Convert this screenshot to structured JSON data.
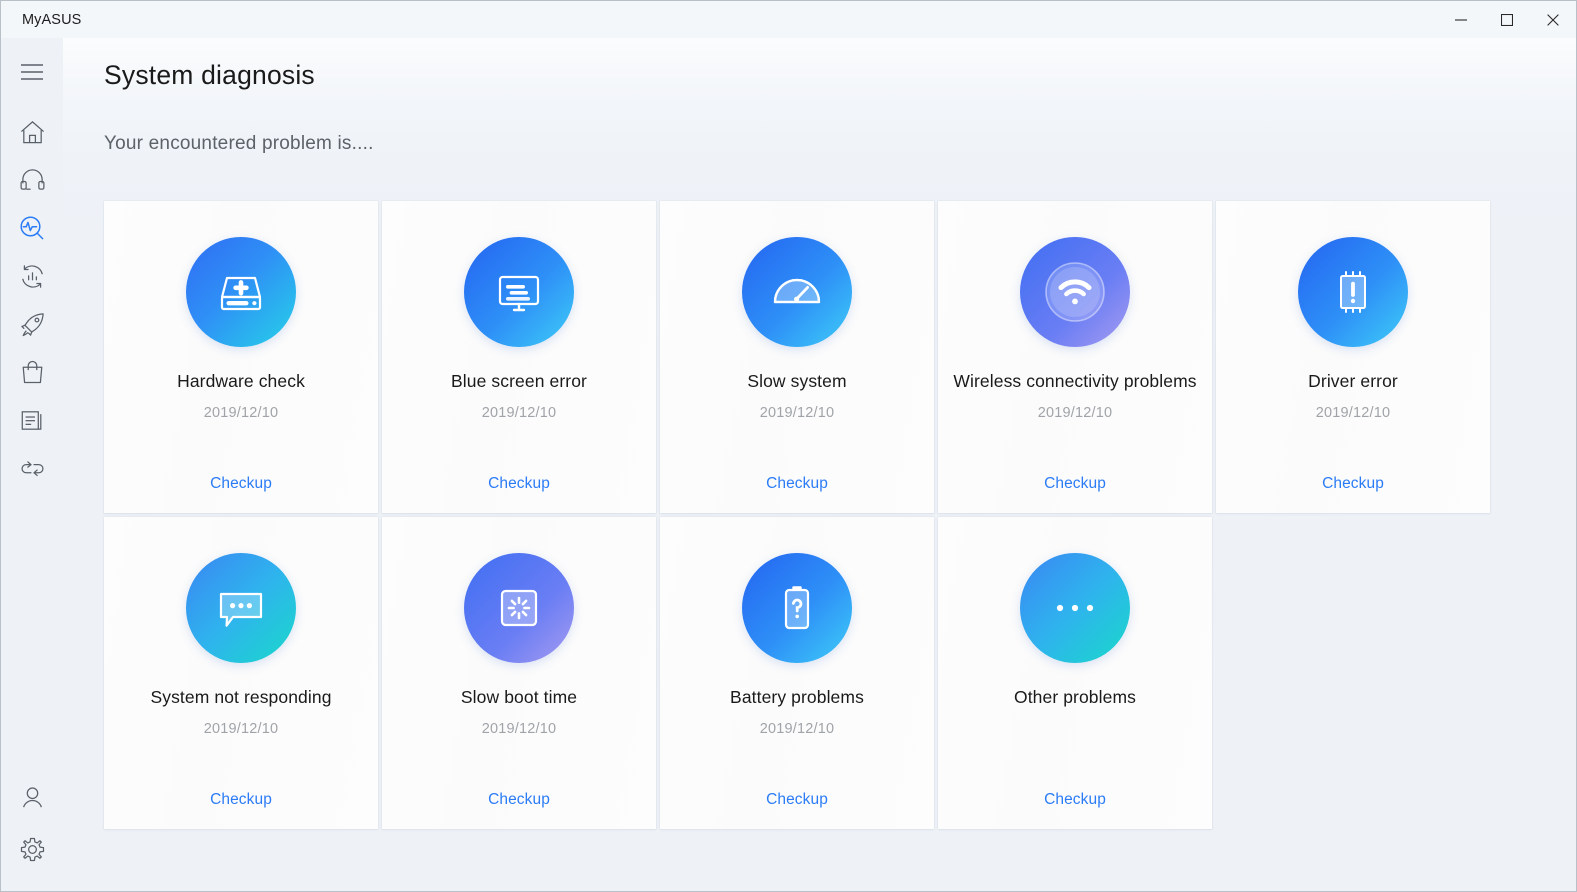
{
  "window": {
    "app_title": "MyASUS",
    "controls": {
      "minimize": "minimize-button",
      "maximize": "maximize-button",
      "close": "close-button"
    }
  },
  "sidebar": {
    "menu_label": "hamburger-menu",
    "items": [
      {
        "icon": "home-icon",
        "name": "home",
        "active": false
      },
      {
        "icon": "headset-icon",
        "name": "support",
        "active": false
      },
      {
        "icon": "diagnosis-icon",
        "name": "diagnosis",
        "active": true
      },
      {
        "icon": "analytics-icon",
        "name": "analytics",
        "active": false
      },
      {
        "icon": "rocket-icon",
        "name": "boost",
        "active": false
      },
      {
        "icon": "shopping-bag-icon",
        "name": "store",
        "active": false
      },
      {
        "icon": "document-icon",
        "name": "documents",
        "active": false
      },
      {
        "icon": "link-sync-icon",
        "name": "link-to-myasus",
        "active": false
      }
    ],
    "bottom_items": [
      {
        "icon": "account-icon",
        "name": "account"
      },
      {
        "icon": "settings-icon",
        "name": "settings"
      }
    ]
  },
  "header": {
    "title": "System diagnosis",
    "subtitle": "Your encountered problem is...."
  },
  "colors": {
    "accent": "#2b7cf6",
    "page_background": "#eef2f7",
    "card_background": "#fdfdfd",
    "title_text": "#1a1a1a",
    "date_text": "#a0a4a9"
  },
  "cards": [
    {
      "title": "Hardware check",
      "date": "2019/12/10",
      "action": "Checkup",
      "icon": "hard-drive-plus-icon",
      "gradient": "g-cyan"
    },
    {
      "title": "Blue screen error",
      "date": "2019/12/10",
      "action": "Checkup",
      "icon": "monitor-text-icon",
      "gradient": "g-blue"
    },
    {
      "title": "Slow system",
      "date": "2019/12/10",
      "action": "Checkup",
      "icon": "speedometer-icon",
      "gradient": "g-blue"
    },
    {
      "title": "Wireless connectivity problems",
      "date": "2019/12/10",
      "action": "Checkup",
      "icon": "wifi-icon",
      "gradient": "g-purple"
    },
    {
      "title": "Driver error",
      "date": "2019/12/10",
      "action": "Checkup",
      "icon": "chip-warning-icon",
      "gradient": "g-blue"
    },
    {
      "title": "System not responding",
      "date": "2019/12/10",
      "action": "Checkup",
      "icon": "speech-bubble-dots-icon",
      "gradient": "g-teal"
    },
    {
      "title": "Slow boot time",
      "date": "2019/12/10",
      "action": "Checkup",
      "icon": "screen-spinner-icon",
      "gradient": "g-purple"
    },
    {
      "title": "Battery problems",
      "date": "2019/12/10",
      "action": "Checkup",
      "icon": "battery-question-icon",
      "gradient": "g-blue"
    },
    {
      "title": "Other problems",
      "date": "",
      "action": "Checkup",
      "icon": "ellipsis-icon",
      "gradient": "g-teal"
    }
  ]
}
